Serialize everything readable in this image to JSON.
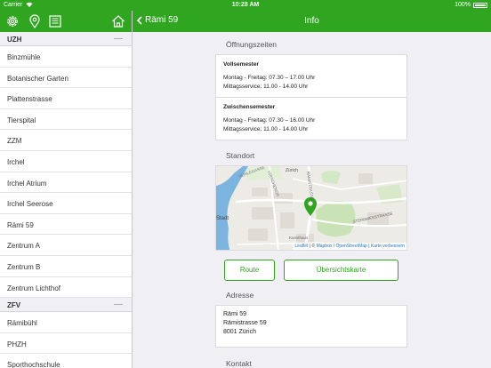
{
  "status": {
    "carrier": "Carrier",
    "time": "10:28 AM",
    "battery": "100%"
  },
  "sidebar_nav": {
    "icons": [
      "gear-icon",
      "map-pin-icon",
      "menu-list-icon",
      "home-icon"
    ]
  },
  "detail_nav": {
    "back_label": "Rämi 59",
    "title": "Info"
  },
  "sidebar": {
    "groups": [
      {
        "name": "UZH",
        "items": [
          "Binzmühle",
          "Botanischer Garten",
          "Plattenstrasse",
          "Tierspital",
          "ZZM",
          "Irchel",
          "Irchel Atrium",
          "Irchel Seerose",
          "Rämi 59",
          "Zentrum A",
          "Zentrum B",
          "Zentrum Lichthof"
        ]
      },
      {
        "name": "ZFV",
        "items": [
          "Rämibühl",
          "PHZH",
          "Sporthochschule"
        ]
      }
    ]
  },
  "info": {
    "hours_title": "Öffnungszeiten",
    "hours": [
      {
        "heading": "Vollsemester",
        "lines": [
          "Montag - Freitag: 07.30 – 17.00 Uhr",
          "Mittagsservice: 11.00 - 14.00 Uhr"
        ]
      },
      {
        "heading": "Zwischensemester",
        "lines": [
          "Montag - Freitag: 07.30 – 16.00 Uhr",
          "Mittagsservice: 11.00 - 14.00 Uhr"
        ]
      }
    ],
    "location_title": "Standort",
    "map": {
      "labels": [
        "HÜHLEGASSE",
        "Zürich",
        "RÄMISTRASSE",
        "STEINWIESSTRASSE",
        "Stadt",
        "Kunsthaus",
        "HIRSCHENGR"
      ],
      "attribution": {
        "leaflet": "Leaflet",
        "sep1": " | © ",
        "mapbox": "Mapbox",
        "sep2": " / ",
        "osm": "OpenStreetMap",
        "sep3": " | ",
        "improve": "Karte verbessern"
      }
    },
    "buttons": {
      "route": "Route",
      "overview": "Übersichtskarte"
    },
    "address_title": "Adresse",
    "address_lines": [
      "Rämi 59",
      "Rämistrasse 59",
      "8001 Zürich"
    ],
    "contact_title": "Kontakt"
  },
  "colors": {
    "brand": "#2fa520",
    "marker": "#2fa520",
    "link": "#2b7bbf"
  }
}
